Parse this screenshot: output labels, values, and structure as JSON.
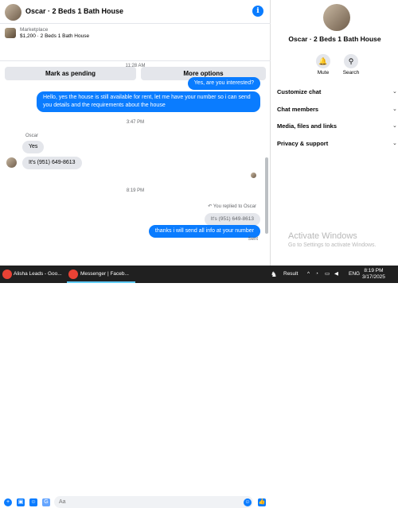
{
  "header": {
    "title": "Oscar · 2 Beds 1 Bath House",
    "info_icon": "i"
  },
  "listing": {
    "label": "Marketplace",
    "detail": "$1,200 · 2 Beds 1 Bath House"
  },
  "actions": {
    "pending": "Mark as pending",
    "more": "More options"
  },
  "messages": {
    "ts1": "11:28 AM",
    "out1": "Yes, are you interested?",
    "out2": "Hello, yes the house is still available for rent, let me have your number so i can send you details and the requirements about the house",
    "ts2": "3:47 PM",
    "sender": "Oscar",
    "in1": "Yes",
    "in2": "It's (951) 649-8613",
    "ts3": "8:19 PM",
    "reply_note": "You replied to Oscar",
    "quoted": "It's (951) 649-8613",
    "out3": "thanks i will send all info at your number",
    "status": "Sent"
  },
  "composer": {
    "placeholder": "Aa"
  },
  "side": {
    "name": "Oscar · 2 Beds 1 Bath House",
    "mute": "Mute",
    "search": "Search",
    "sections": [
      "Customize chat",
      "Chat members",
      "Media, files and links",
      "Privacy & support"
    ]
  },
  "watermark": {
    "title": "Activate Windows",
    "subtitle": "Go to Settings to activate Windows."
  },
  "taskbar": {
    "task1": "Alisha Leads - Goo...",
    "task2": "Messenger | Faceb...",
    "result": "Result",
    "lang": "ENG",
    "time": "8:19 PM",
    "date": "3/17/2025"
  },
  "colors": {
    "accent": "#0a7cff",
    "bubble_in": "#e4e6eb",
    "taskbar": "#202020"
  }
}
